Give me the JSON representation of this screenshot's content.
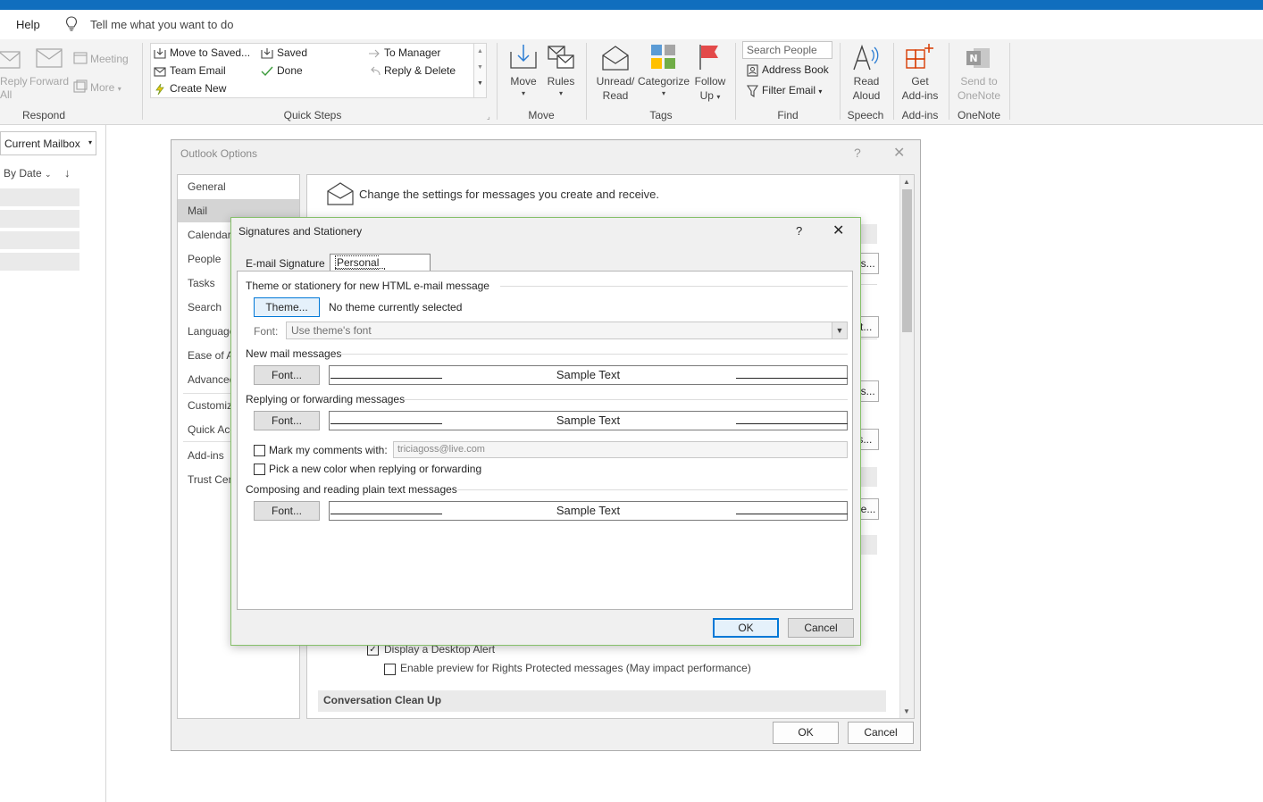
{
  "helpbar": {
    "help_tab": "Help",
    "tell_me": "Tell me what you want to do"
  },
  "ribbon": {
    "respond": {
      "reply_all": "Reply\nAll",
      "forward": "Forward",
      "meeting": "Meeting",
      "more": "More",
      "group": "Respond"
    },
    "quick_steps": {
      "items": [
        "Move to Saved...",
        "Team Email",
        "Create New",
        "Saved",
        "Done",
        "To Manager",
        "Reply & Delete"
      ],
      "group": "Quick Steps"
    },
    "move": {
      "move": "Move",
      "rules": "Rules",
      "group": "Move"
    },
    "tags": {
      "unread_read_1": "Unread/",
      "unread_read_2": "Read",
      "categorize": "Categorize",
      "follow_up_1": "Follow",
      "follow_up_2": "Up",
      "group": "Tags"
    },
    "find": {
      "search_people": "Search People",
      "address_book": "Address Book",
      "filter_email": "Filter Email",
      "group": "Find"
    },
    "speech": {
      "read_aloud_1": "Read",
      "read_aloud_2": "Aloud",
      "group": "Speech"
    },
    "addins": {
      "get_addins_1": "Get",
      "get_addins_2": "Add-ins",
      "group": "Add-ins"
    },
    "onenote": {
      "send_1": "Send to",
      "send_2": "OneNote",
      "group": "OneNote"
    }
  },
  "leftpane": {
    "mailbox": "Current Mailbox",
    "sort": "By Date"
  },
  "options": {
    "title": "Outlook Options",
    "help": "?",
    "nav": [
      "General",
      "Mail",
      "Calendar",
      "People",
      "Tasks",
      "Search",
      "Language",
      "Ease of Access",
      "Advanced",
      "Customize Ribbon",
      "Quick Access Toolbar",
      "Add-ins",
      "Trust Center"
    ],
    "header": "Change the settings for messages you create and receive.",
    "stub_buttons": [
      "ns...",
      "ct...",
      "es...",
      "ts...",
      "ne..."
    ],
    "desktop_alert": "Display a Desktop Alert",
    "rights_preview": "Enable preview for Rights Protected messages (May impact performance)",
    "conversation": "Conversation Clean Up",
    "ok": "OK",
    "cancel": "Cancel"
  },
  "sig": {
    "title": "Signatures and Stationery",
    "help": "?",
    "tab_email": "E-mail Signature",
    "tab_personal": "Personal Stationery",
    "theme_section": "Theme or stationery for new HTML e-mail message",
    "theme_button": "Theme...",
    "theme_status": "No theme currently selected",
    "font_label": "Font:",
    "font_value": "Use theme's font",
    "new_mail": "New mail messages",
    "replying": "Replying or forwarding messages",
    "composing": "Composing and reading plain text messages",
    "font_button": "Font...",
    "sample_text": "Sample Text",
    "mark_comments": "Mark my comments with:",
    "mark_value": "triciagoss@live.com",
    "pick_color": "Pick a new color when replying or forwarding",
    "ok": "OK",
    "cancel": "Cancel"
  },
  "colors": {
    "accent": "#0078d7",
    "title_bar": "#106ebe",
    "dialog_border": "#86c06a"
  }
}
